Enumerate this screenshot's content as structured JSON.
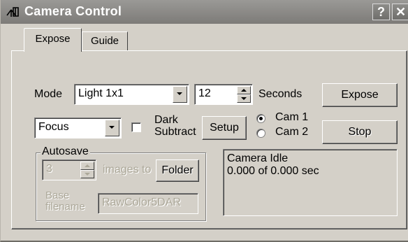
{
  "window": {
    "title": "Camera Control",
    "help_button": "?",
    "close_button": "✕"
  },
  "tabs": [
    {
      "label": "Expose",
      "active": true
    },
    {
      "label": "Guide",
      "active": false
    }
  ],
  "expose": {
    "mode_label": "Mode",
    "mode_value": "Light 1x1",
    "duration_value": "12",
    "duration_unit": "Seconds",
    "expose_button": "Expose",
    "focus_value": "Focus",
    "dark_subtract_line1": "Dark",
    "dark_subtract_line2": "Subtract",
    "dark_subtract_checked": false,
    "setup_button": "Setup",
    "cam1_label": "Cam 1",
    "cam2_label": "Cam 2",
    "cam_selected": "Cam 1",
    "stop_button": "Stop",
    "autosave": {
      "group_label": "Autosave",
      "count_value": "3",
      "images_to_label": "images to",
      "folder_button": "Folder",
      "base_filename_line1": "Base",
      "base_filename_line2": "filename",
      "base_filename_value": "RawColor5DAR"
    },
    "status": {
      "line1": "Camera Idle",
      "line2": "0.000 of 0.000 sec"
    }
  },
  "colors": {
    "face": "#d4d0c8",
    "titlebar": "#8a8986",
    "disabled_text": "#aca899"
  }
}
